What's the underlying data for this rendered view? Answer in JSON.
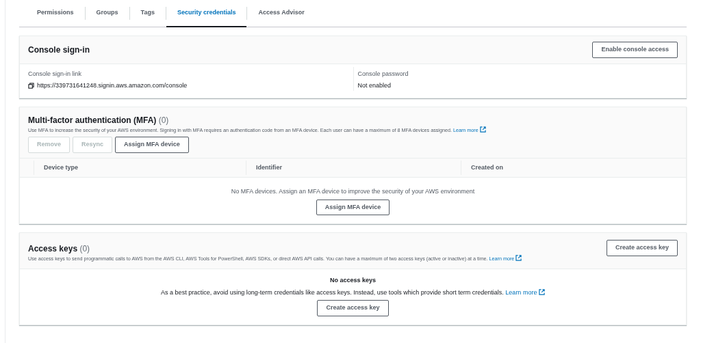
{
  "tabs": [
    {
      "label": "Permissions",
      "selected": false
    },
    {
      "label": "Groups",
      "selected": false
    },
    {
      "label": "Tags",
      "selected": false
    },
    {
      "label": "Security credentials",
      "selected": true
    },
    {
      "label": "Access Advisor",
      "selected": false
    }
  ],
  "console_signin": {
    "title": "Console sign-in",
    "button": "Enable console access",
    "fields": [
      {
        "label": "Console sign-in link",
        "value": "https://339731641248.signin.aws.amazon.com/console",
        "kind": "copyable"
      },
      {
        "label": "Console password",
        "value": "Not enabled",
        "kind": "text"
      }
    ]
  },
  "mfa": {
    "title": "Multi-factor authentication (MFA)",
    "count": "(0)",
    "description": "Use MFA to increase the security of your AWS environment. Signing in with MFA requires an authentication code from an MFA device. Each user can have a maximum of 8 MFA devices assigned.",
    "learn_more": "Learn more",
    "buttons": [
      {
        "label": "Remove",
        "disabled": true
      },
      {
        "label": "Resync",
        "disabled": true
      },
      {
        "label": "Assign MFA device",
        "disabled": false
      }
    ],
    "columns": [
      "Device type",
      "Identifier",
      "Created on"
    ],
    "empty_message": "No MFA devices. Assign an MFA device to improve the security of your AWS environment",
    "empty_button": "Assign MFA device"
  },
  "access_keys": {
    "title": "Access keys",
    "count": "(0)",
    "description": "Use access keys to send programmatic calls to AWS from the AWS CLI, AWS Tools for PowerShell, AWS SDKs, or direct AWS API calls. You can have a maximum of two access keys (active or inactive) at a time.",
    "learn_more": "Learn more",
    "button": "Create access key",
    "empty_title": "No access keys",
    "empty_description": "As a best practice, avoid using long-term credentials like access keys. Instead, use tools which provide short term credentials.",
    "empty_learn_more": "Learn more",
    "empty_button": "Create access key"
  }
}
